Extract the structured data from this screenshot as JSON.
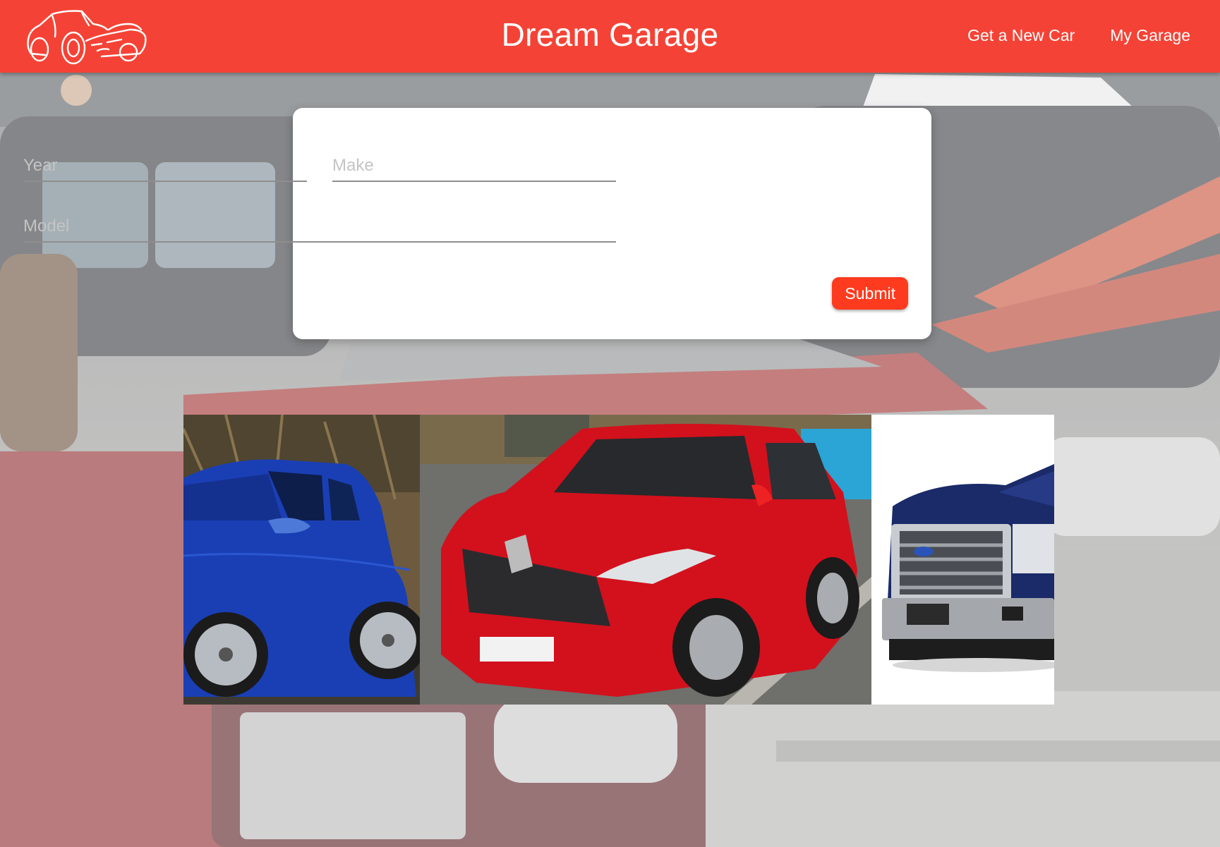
{
  "app": {
    "brand": "Dream Garage"
  },
  "nav": {
    "items": [
      {
        "label": "Get a New Car"
      },
      {
        "label": "My Garage"
      }
    ]
  },
  "form": {
    "year_placeholder": "Year",
    "make_placeholder": "Make",
    "model_placeholder": "Model",
    "submit_label": "Submit"
  },
  "gallery": {
    "photos": [
      {
        "depicts": "blue sedan"
      },
      {
        "depicts": "red SUV"
      },
      {
        "depicts": "blue pickup truck"
      }
    ]
  },
  "colors": {
    "header": "#f44336",
    "submit": "#ff3b1f",
    "card": "#ffffff"
  },
  "icons": {
    "logo": "car-sketch-logo-icon"
  }
}
